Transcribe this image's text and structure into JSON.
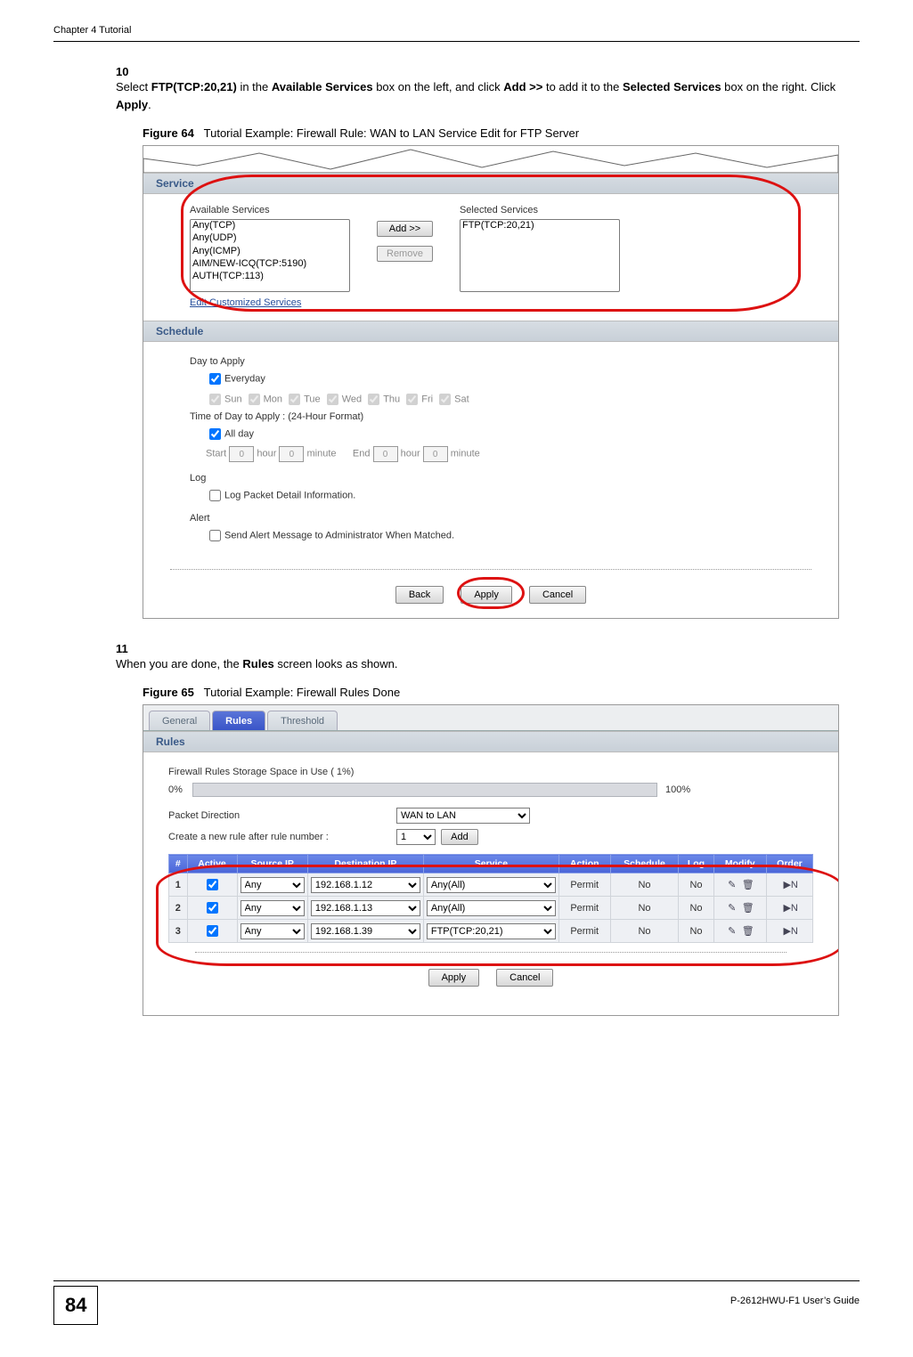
{
  "header": {
    "chapter": "Chapter 4 Tutorial"
  },
  "step10": {
    "num": "10",
    "text_parts": {
      "p1": "Select ",
      "b1": "FTP(TCP:20,21)",
      "p2": " in the ",
      "b2": "Available Services",
      "p3": " box on the left, and click ",
      "b3": "Add >>",
      "p4": " to add it to the ",
      "b4": "Selected Services",
      "p5": " box on the right. Click ",
      "b5": "Apply",
      "p6": "."
    }
  },
  "fig64": {
    "label": "Figure 64",
    "caption": "Tutorial Example: Firewall Rule: WAN to LAN Service Edit for FTP Server"
  },
  "svc": {
    "section": "Service",
    "available_label": "Available Services",
    "selected_label": "Selected Services",
    "available": [
      "Any(TCP)",
      "Any(UDP)",
      "Any(ICMP)",
      "AIM/NEW-ICQ(TCP:5190)",
      "AUTH(TCP:113)"
    ],
    "selected": [
      "FTP(TCP:20,21)"
    ],
    "add_btn": "Add >>",
    "remove_btn": "Remove",
    "edit_link": "Edit Customized Services"
  },
  "sched": {
    "section": "Schedule",
    "day_label": "Day to Apply",
    "everyday": "Everyday",
    "days": {
      "sun": "Sun",
      "mon": "Mon",
      "tue": "Tue",
      "wed": "Wed",
      "thu": "Thu",
      "fri": "Fri",
      "sat": "Sat"
    },
    "time_label": "Time of Day to Apply : (24-Hour Format)",
    "all_day": "All day",
    "start": "Start",
    "end": "End",
    "hour": "hour",
    "minute": "minute",
    "zero": "0",
    "log_label": "Log",
    "log_text": "Log Packet Detail Information.",
    "alert_label": "Alert",
    "alert_text": "Send Alert Message to Administrator When Matched."
  },
  "btns": {
    "back": "Back",
    "apply": "Apply",
    "cancel": "Cancel",
    "add": "Add"
  },
  "step11": {
    "num": "11",
    "text_parts": {
      "p1": "When you are done, the ",
      "b1": "Rules",
      "p2": " screen looks as shown."
    }
  },
  "fig65": {
    "label": "Figure 65",
    "caption": "Tutorial Example: Firewall Rules Done"
  },
  "tabs": {
    "general": "General",
    "rules": "Rules",
    "threshold": "Threshold"
  },
  "rules": {
    "section": "Rules",
    "storage_label": "Firewall Rules Storage Space in Use  ( 1%)",
    "zero_pct": "0%",
    "hundred_pct": "100%",
    "pd_label": "Packet Direction",
    "pd_value": "WAN to LAN",
    "create_label": "Create a new rule after rule number :",
    "create_value": "1",
    "headers": {
      "num": "#",
      "active": "Active",
      "src": "Source IP",
      "dst": "Destination IP",
      "svc": "Service",
      "action": "Action",
      "sched": "Schedule",
      "log": "Log",
      "modify": "Modify",
      "order": "Order"
    },
    "rows": [
      {
        "n": "1",
        "src": "Any",
        "dst": "192.168.1.12",
        "svc": "Any(All)",
        "action": "Permit",
        "sched": "No",
        "log": "No"
      },
      {
        "n": "2",
        "src": "Any",
        "dst": "192.168.1.13",
        "svc": "Any(All)",
        "action": "Permit",
        "sched": "No",
        "log": "No"
      },
      {
        "n": "3",
        "src": "Any",
        "dst": "192.168.1.39",
        "svc": "FTP(TCP:20,21)",
        "action": "Permit",
        "sched": "No",
        "log": "No"
      }
    ]
  },
  "footer": {
    "page": "84",
    "guide": "P-2612HWU-F1 User’s Guide"
  }
}
